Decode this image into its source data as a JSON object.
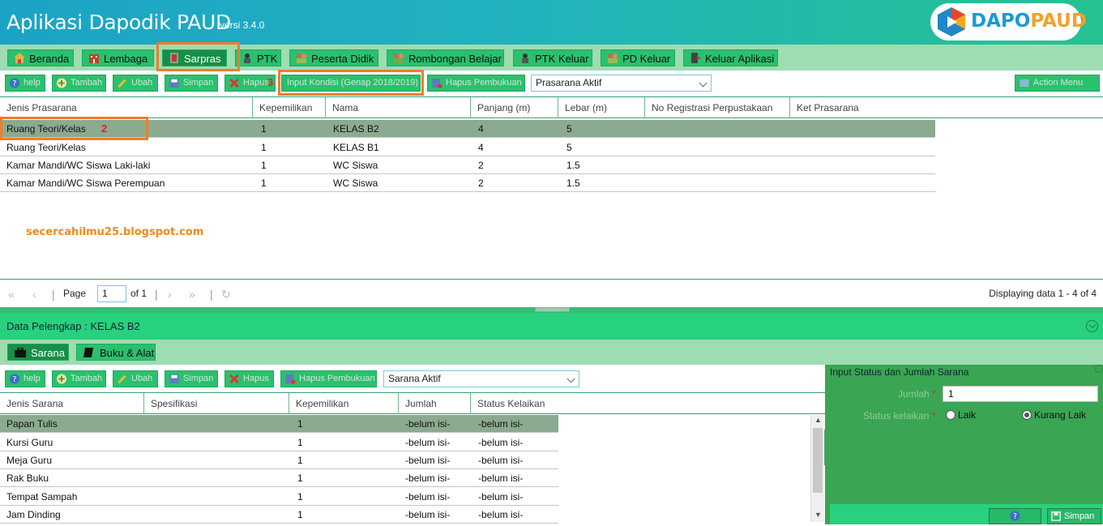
{
  "app": {
    "title": "Aplikasi Dapodik PAUD",
    "version": "versi 3.4.0",
    "logo_left": "DAPO",
    "logo_right": "PAUD"
  },
  "menu": [
    {
      "label": "Beranda",
      "icon": "home-icon"
    },
    {
      "label": "Lembaga",
      "icon": "building-icon"
    },
    {
      "label": "Sarpras",
      "icon": "door-icon",
      "active": true
    },
    {
      "label": "PTK",
      "icon": "teacher-icon"
    },
    {
      "label": "Peserta Didik",
      "icon": "students-icon"
    },
    {
      "label": "Rombongan Belajar",
      "icon": "group-icon"
    },
    {
      "label": "PTK Keluar",
      "icon": "teacher-out-icon"
    },
    {
      "label": "PD Keluar",
      "icon": "student-out-icon"
    },
    {
      "label": "Keluar Aplikasi",
      "icon": "exit-icon"
    }
  ],
  "toolbar": {
    "help": "help",
    "tambah": "Tambah",
    "ubah": "Ubah",
    "simpan": "Simpan",
    "hapus": "Hapus",
    "input_kondisi": "Input Kondisi (Genap 2018/2019)",
    "hapus_pembukuan": "Hapus Pembukuan",
    "filter_value": "Prasarana Aktif",
    "action_menu": "Action Menu"
  },
  "annotations": {
    "n2": "2",
    "n3": "3",
    "watermark": "secercahilmu25.blogspot.com"
  },
  "prasarana_grid": {
    "columns": [
      "Jenis Prasarana",
      "Kepemilikan",
      "Nama",
      "Panjang (m)",
      "Lebar (m)",
      "No Registrasi Perpustakaan",
      "Ket Prasarana"
    ],
    "rows": [
      [
        "Ruang Teori/Kelas",
        "1",
        "KELAS B2",
        "4",
        "5",
        "",
        ""
      ],
      [
        "Ruang Teori/Kelas",
        "1",
        "KELAS B1",
        "4",
        "5",
        "",
        ""
      ],
      [
        "Kamar Mandi/WC Siswa Laki-laki",
        "1",
        "WC Siswa",
        "2",
        "1.5",
        "",
        ""
      ],
      [
        "Kamar Mandi/WC Siswa Perempuan",
        "1",
        "WC Siswa",
        "2",
        "1.5",
        "",
        ""
      ]
    ]
  },
  "pager": {
    "page_label": "Page",
    "page_value": "1",
    "of_label": "of 1",
    "display": "Displaying data 1 - 4 of 4"
  },
  "detail": {
    "title": "Data Pelengkap : KELAS B2",
    "tabs": [
      "Sarana",
      "Buku & Alat"
    ],
    "toolbar": {
      "help": "help",
      "tambah": "Tambah",
      "ubah": "Ubah",
      "simpan": "Simpan",
      "hapus": "Hapus",
      "hapus_pembukuan": "Hapus Pembukuan",
      "filter_value": "Sarana Aktif"
    },
    "columns": [
      "Jenis Sarana",
      "Spesifikasi",
      "Kepemilikan",
      "Jumlah",
      "Status Kelaikan"
    ],
    "rows": [
      [
        "Papan Tulis",
        "",
        "1",
        "-belum isi-",
        "-belum isi-"
      ],
      [
        "Kursi Guru",
        "",
        "1",
        "-belum isi-",
        "-belum isi-"
      ],
      [
        "Meja Guru",
        "",
        "1",
        "-belum isi-",
        "-belum isi-"
      ],
      [
        "Rak Buku",
        "",
        "1",
        "-belum isi-",
        "-belum isi-"
      ],
      [
        "Tempat Sampah",
        "",
        "1",
        "-belum isi-",
        "-belum isi-"
      ],
      [
        "Jam Dinding",
        "",
        "1",
        "-belum isi-",
        "-belum isi-"
      ]
    ]
  },
  "form": {
    "title": "Input Status dan Jumlah Sarana",
    "jumlah_label": "Jumlah",
    "jumlah_value": "1",
    "status_label": "Status kelaikan",
    "opt_laik": "Laik",
    "opt_kurang": "Kurang Laik",
    "selected": "Kurang Laik",
    "required_mark": "*",
    "save": "Simpan",
    "help": "?"
  },
  "colors": {
    "accent": "#2bc06d",
    "dark": "#178f46",
    "highlight": "#f07d2a",
    "header_start": "#1ba3c6",
    "header_end": "#24c28f"
  }
}
